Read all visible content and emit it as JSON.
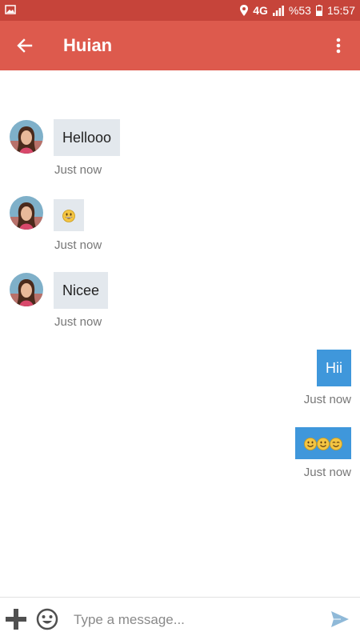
{
  "status_bar": {
    "network": "4G",
    "battery": "%53",
    "time": "15:57",
    "icons": [
      "image-icon",
      "location-icon",
      "signal-icon",
      "battery-icon"
    ]
  },
  "app_bar": {
    "title": "Huian",
    "background": "#dd5a4d",
    "status_background": "#c6443a"
  },
  "messages": [
    {
      "direction": "incoming",
      "text": "Hellooo",
      "time": "Just now"
    },
    {
      "direction": "incoming",
      "emoji": [
        "grinning-face"
      ],
      "time": "Just now"
    },
    {
      "direction": "incoming",
      "text": "Nicee",
      "time": "Just now"
    },
    {
      "direction": "outgoing",
      "text": "Hii",
      "time": "Just now"
    },
    {
      "direction": "outgoing",
      "emoji": [
        "smiling-face",
        "smiling-face",
        "smiling-face"
      ],
      "time": "Just now"
    }
  ],
  "colors": {
    "incoming_bubble": "#e3e8ed",
    "outgoing_bubble": "#3f97db",
    "timestamp": "#777777"
  },
  "composer": {
    "placeholder": "Type a message..."
  }
}
